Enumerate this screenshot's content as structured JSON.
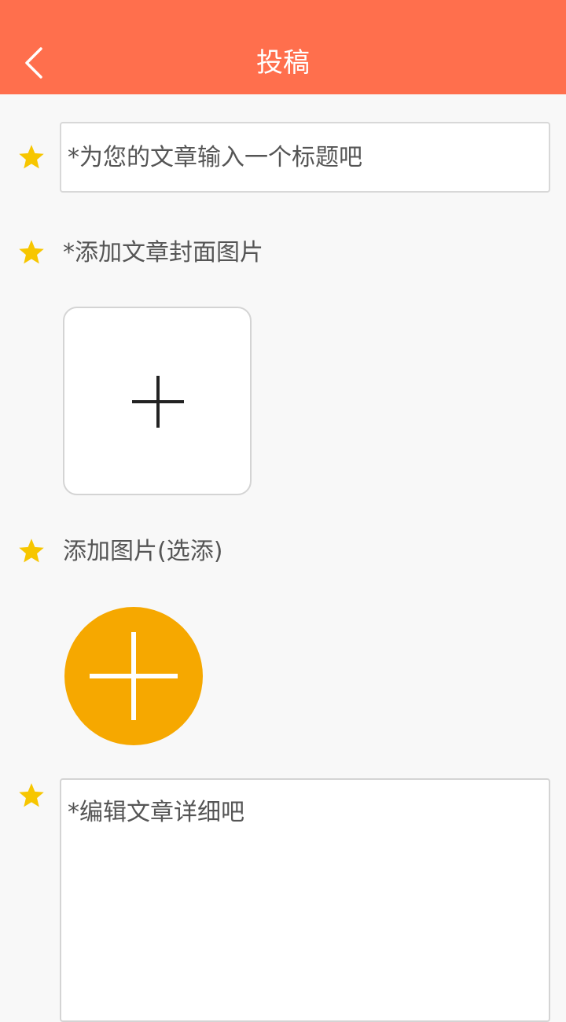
{
  "header": {
    "title": "投稿",
    "background_color": "#ff6f4d",
    "back_icon": "chevron-left-icon"
  },
  "form": {
    "required_marker_icon": "star-icon",
    "marker_color": "#f7c600",
    "title_field": {
      "placeholder": "*为您的文章输入一个标题吧",
      "value": ""
    },
    "cover_section": {
      "label": "*添加文章封面图片",
      "add_icon": "plus-icon"
    },
    "images_section": {
      "label": "添加图片(选添)",
      "add_icon": "plus-icon",
      "button_color": "#f6a800"
    },
    "content_field": {
      "placeholder": "*编辑文章详细吧",
      "value": ""
    }
  }
}
